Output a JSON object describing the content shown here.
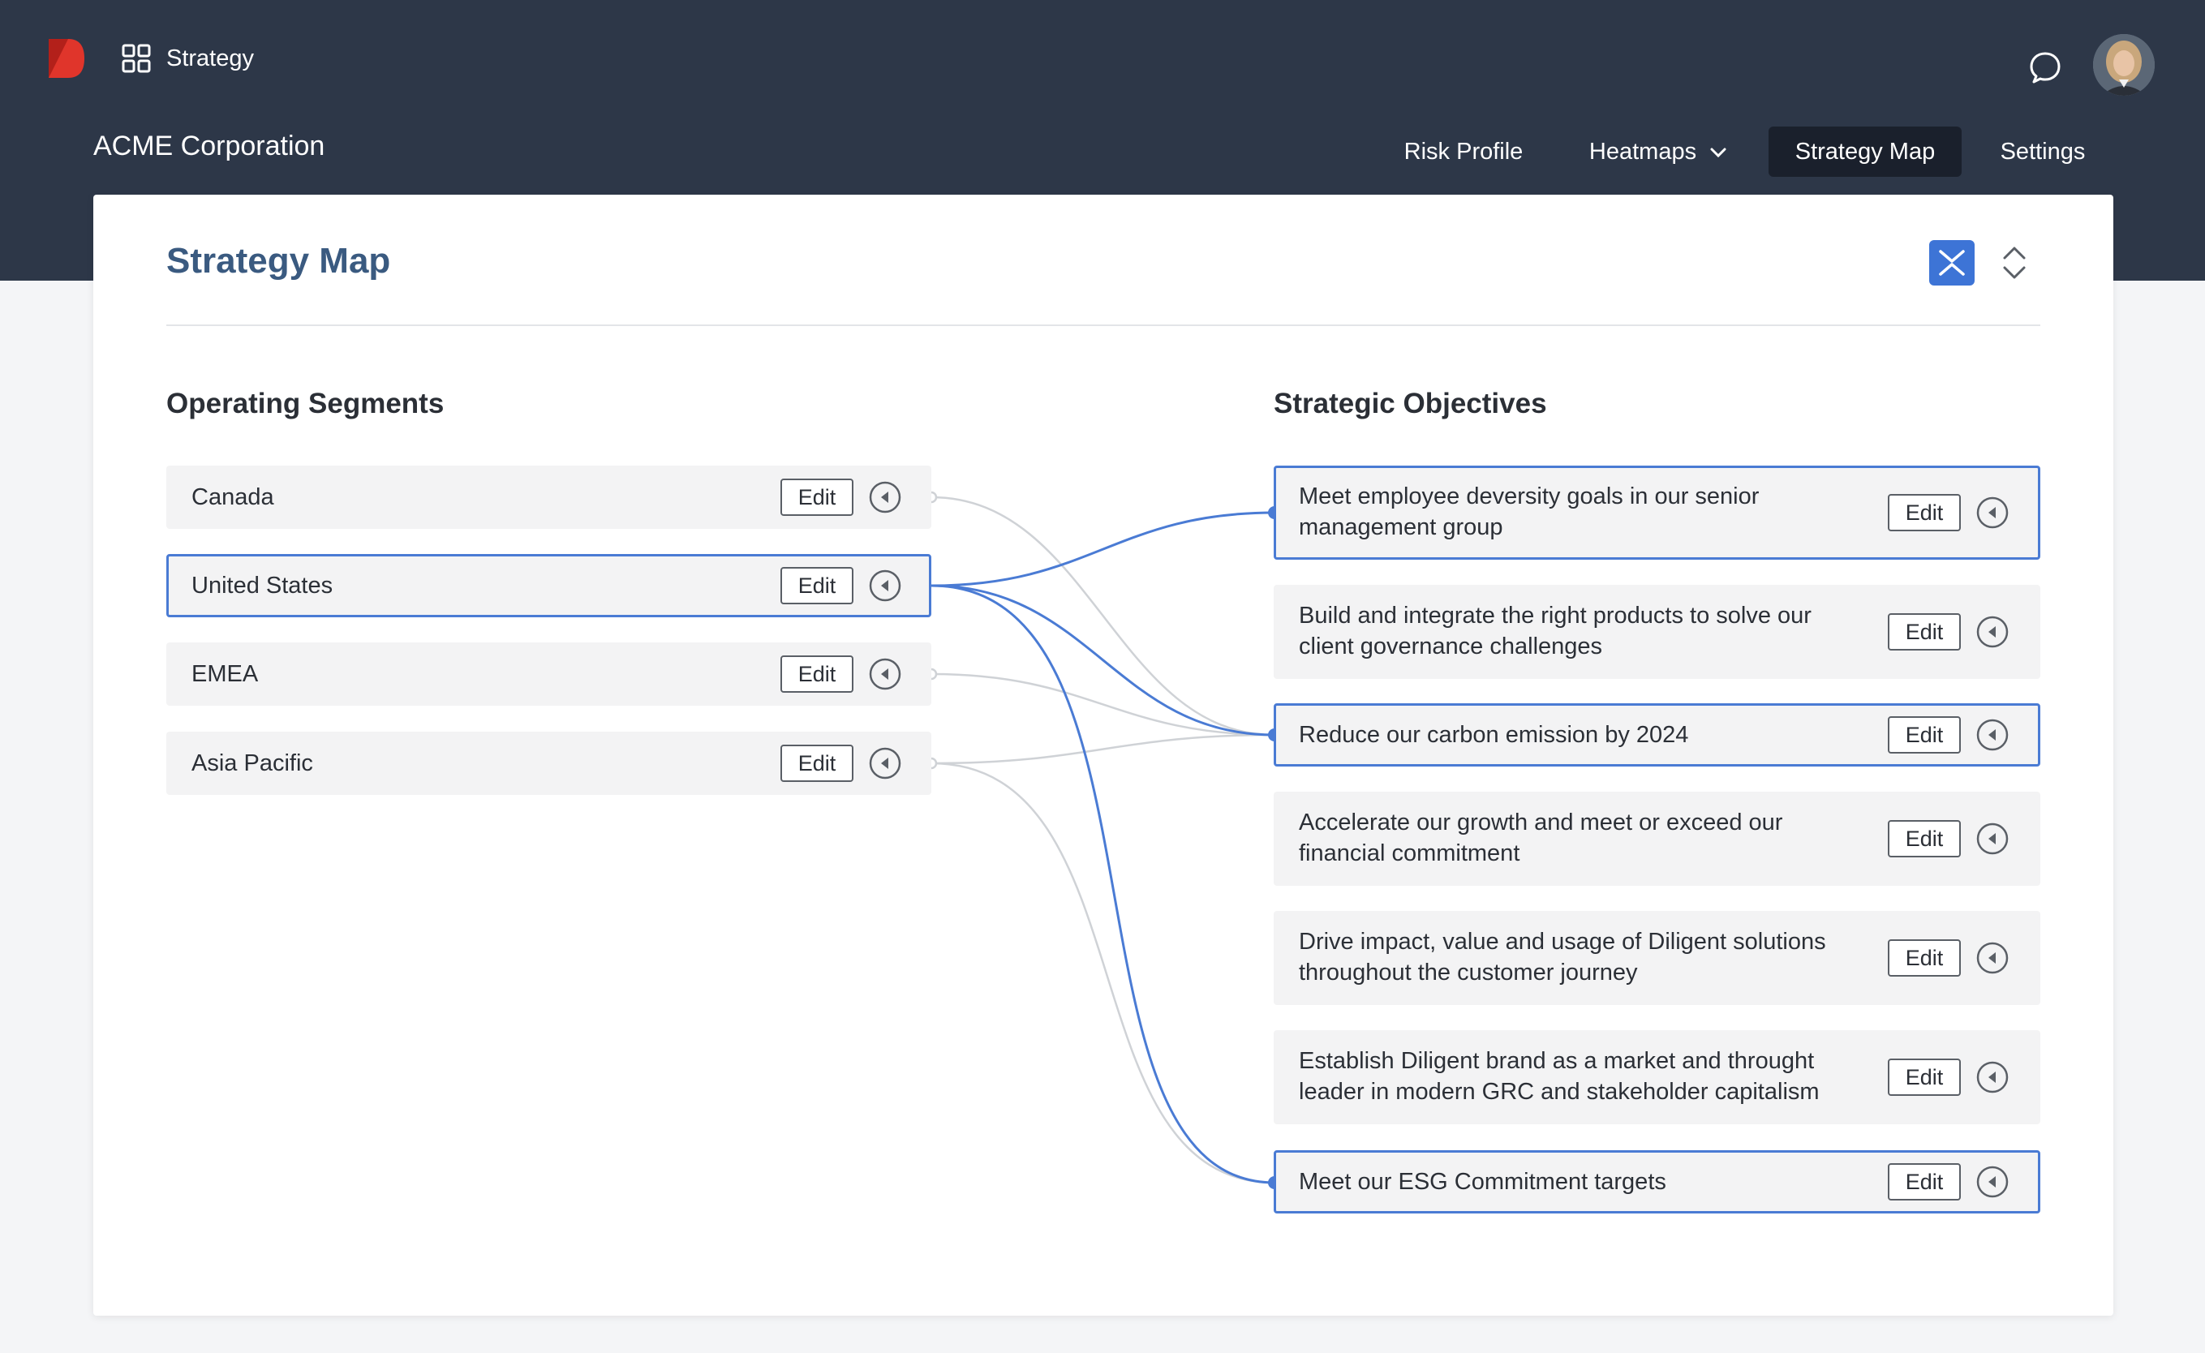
{
  "topbar": {
    "app_name": "Strategy",
    "org_name": "ACME Corporation"
  },
  "nav": {
    "items": [
      {
        "label": "Risk Profile"
      },
      {
        "label": "Heatmaps"
      },
      {
        "label": "Strategy Map"
      },
      {
        "label": "Settings"
      }
    ],
    "active": "Strategy Map"
  },
  "card": {
    "title": "Strategy Map"
  },
  "left": {
    "title": "Operating Segments",
    "items": [
      {
        "label": "Canada",
        "edit": "Edit"
      },
      {
        "label": "United States",
        "edit": "Edit"
      },
      {
        "label": "EMEA",
        "edit": "Edit"
      },
      {
        "label": "Asia Pacific",
        "edit": "Edit"
      }
    ]
  },
  "right": {
    "title": "Strategic Objectives",
    "items": [
      {
        "line1": "Meet employee deversity goals in our senior",
        "line2": "management group",
        "edit": "Edit"
      },
      {
        "line1": "Build and integrate the right products to solve our",
        "line2": "client governance challenges",
        "edit": "Edit"
      },
      {
        "line1": "Reduce our carbon emission by 2024",
        "line2": "",
        "edit": "Edit"
      },
      {
        "line1": "Accelerate our growth and meet or exceed our",
        "line2": "financial commitment",
        "edit": "Edit"
      },
      {
        "line1": "Drive impact, value and usage of Diligent solutions",
        "line2": "throughout the customer journey",
        "edit": "Edit"
      },
      {
        "line1": "Establish Diligent brand as a market and throught",
        "line2": "leader in modern GRC and stakeholder capitalism",
        "edit": "Edit"
      },
      {
        "line1": "Meet our ESG Commitment targets",
        "line2": "",
        "edit": "Edit"
      }
    ]
  },
  "colors": {
    "header_bg": "#2d3748",
    "accent": "#4a7bd4",
    "title": "#3a5a80",
    "brand_red": "#e0352b"
  },
  "icons": [
    "diligent-logo",
    "apps-grid-icon",
    "chat-bubble-icon",
    "avatar",
    "chevron-down-icon",
    "collapse-icon",
    "expand-icon",
    "left-arrow-circle-icon"
  ]
}
